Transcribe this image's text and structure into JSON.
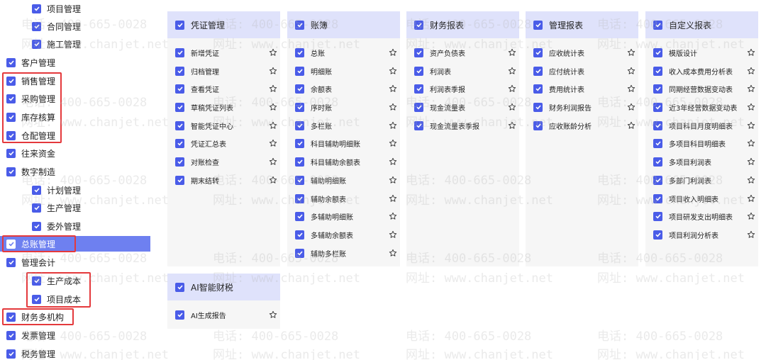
{
  "sidebar": {
    "items": [
      {
        "label": "项目管理",
        "level": 1
      },
      {
        "label": "合同管理",
        "level": 1
      },
      {
        "label": "施工管理",
        "level": 1
      },
      {
        "label": "客户管理",
        "level": 0
      },
      {
        "label": "销售管理",
        "level": 0
      },
      {
        "label": "采购管理",
        "level": 0
      },
      {
        "label": "库存核算",
        "level": 0
      },
      {
        "label": "仓配管理",
        "level": 0
      },
      {
        "label": "往来资金",
        "level": 0
      },
      {
        "label": "数字制造",
        "level": 0
      },
      {
        "label": "计划管理",
        "level": 1
      },
      {
        "label": "生产管理",
        "level": 1
      },
      {
        "label": "委外管理",
        "level": 1
      },
      {
        "label": "总账管理",
        "level": 0,
        "active": true
      },
      {
        "label": "管理会计",
        "level": 0
      },
      {
        "label": "生产成本",
        "level": 1
      },
      {
        "label": "项目成本",
        "level": 1
      },
      {
        "label": "财务多机构",
        "level": 0
      },
      {
        "label": "发票管理",
        "level": 0
      },
      {
        "label": "税务管理",
        "level": 0
      }
    ]
  },
  "panels": [
    {
      "title": "凭证管理",
      "items": [
        "新增凭证",
        "归档管理",
        "查看凭证",
        "草稿凭证列表",
        "智能凭证中心",
        "凭证汇总表",
        "对账检查",
        "期末结转"
      ]
    },
    {
      "title": "账簿",
      "items": [
        "总账",
        "明细账",
        "余额表",
        "序时账",
        "多栏账",
        "科目辅助明细账",
        "科目辅助余额表",
        "辅助明细账",
        "辅助余额表",
        "多辅助明细账",
        "多辅助余额表",
        "辅助多栏账"
      ]
    },
    {
      "title": "财务报表",
      "items": [
        "资产负债表",
        "利润表",
        "利润表季报",
        "现金流量表",
        "现金流量表季报"
      ]
    },
    {
      "title": "管理报表",
      "items": [
        "应收统计表",
        "应付统计表",
        "费用统计表",
        "财务利润报告",
        "应收账龄分析"
      ]
    },
    {
      "title": "自定义报表",
      "items": [
        "模版设计",
        "收入成本费用分析表",
        "同期经营数据变动表",
        "近3年经营数据变动表",
        "项目科目月度明细表",
        "多项目科目明细表",
        "多项目利润表",
        "多部门利润表",
        "项目收入明细表",
        "项目研发支出明细表",
        "项目利润分析表"
      ]
    },
    {
      "title": "AI智能财税",
      "items": [
        "AI生成报告"
      ]
    }
  ],
  "watermark": {
    "phone": "电话: 400-665-0028",
    "site": "网址: www.chanjet.net"
  },
  "colors": {
    "accent": "#4a5ce8",
    "active_row": "#6e80f0",
    "panel_header": "#dfe2fb",
    "panel_bg": "#f6f6f6",
    "highlight_box": "#e4393c"
  }
}
